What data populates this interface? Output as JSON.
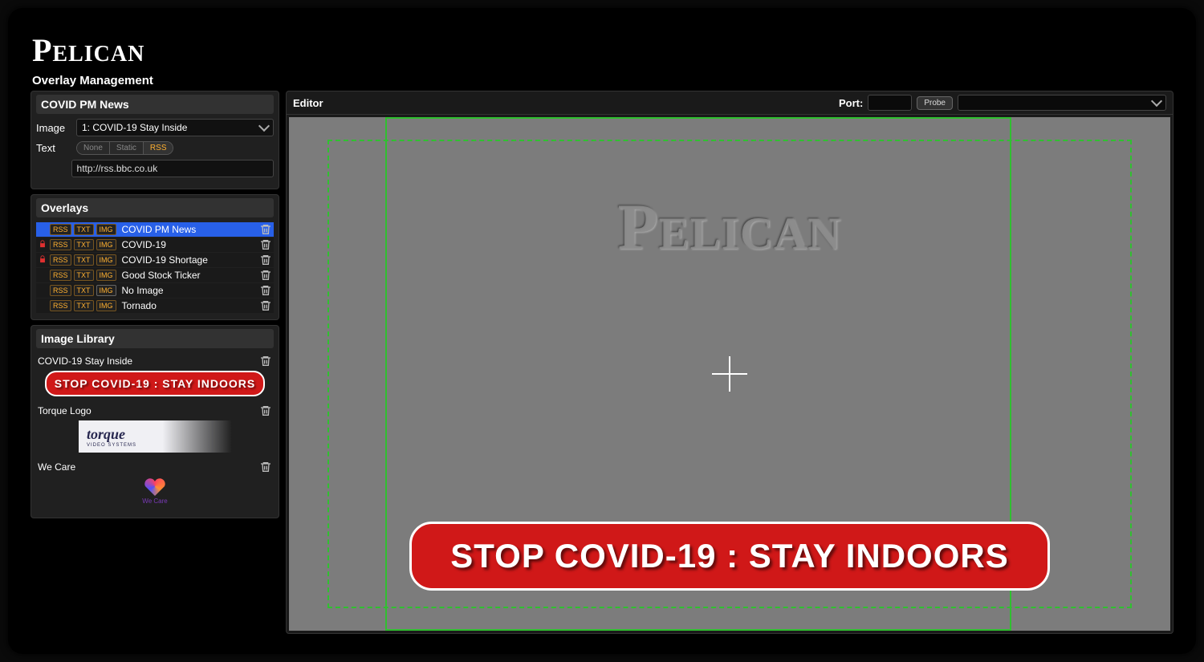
{
  "app_name": "Pelican",
  "page_title": "Overlay Management",
  "top_item": {
    "title": "COVID PM News",
    "image_label": "Image",
    "image_select": "1: COVID-19 Stay Inside",
    "text_label": "Text",
    "text_modes": {
      "none": "None",
      "static": "Static",
      "rss": "RSS"
    },
    "text_mode_active": "RSS",
    "url": "http://rss.bbc.co.uk"
  },
  "overlays": {
    "title": "Overlays",
    "items": [
      {
        "locked": false,
        "rss": true,
        "txt": true,
        "img": true,
        "name": "COVID PM News",
        "selected": true
      },
      {
        "locked": true,
        "rss": true,
        "txt": true,
        "img": true,
        "name": "COVID-19",
        "selected": false
      },
      {
        "locked": true,
        "rss": true,
        "txt": true,
        "img": true,
        "name": "COVID-19 Shortage",
        "selected": false
      },
      {
        "locked": false,
        "rss": true,
        "txt": true,
        "img": true,
        "name": "Good Stock Ticker",
        "selected": false
      },
      {
        "locked": false,
        "rss": true,
        "txt": true,
        "img": false,
        "name": "No Image",
        "selected": false
      },
      {
        "locked": false,
        "rss": true,
        "txt": true,
        "img": true,
        "name": "Tornado",
        "selected": false
      }
    ]
  },
  "image_library": {
    "title": "Image Library",
    "items": [
      {
        "name": "COVID-19 Stay Inside",
        "kind": "banner",
        "banner_text": "STOP COVID-19 : STAY INDOORS"
      },
      {
        "name": "Torque Logo",
        "kind": "torque",
        "title": "torque",
        "subtitle": "VIDEO SYSTEMS"
      },
      {
        "name": "We Care",
        "kind": "wecare",
        "caption": "We Care"
      }
    ]
  },
  "editor": {
    "title": "Editor",
    "port_label": "Port:",
    "probe_btn": "Probe",
    "watermark": "Pelican",
    "banner_text": "STOP COVID-19 : STAY INDOORS"
  }
}
